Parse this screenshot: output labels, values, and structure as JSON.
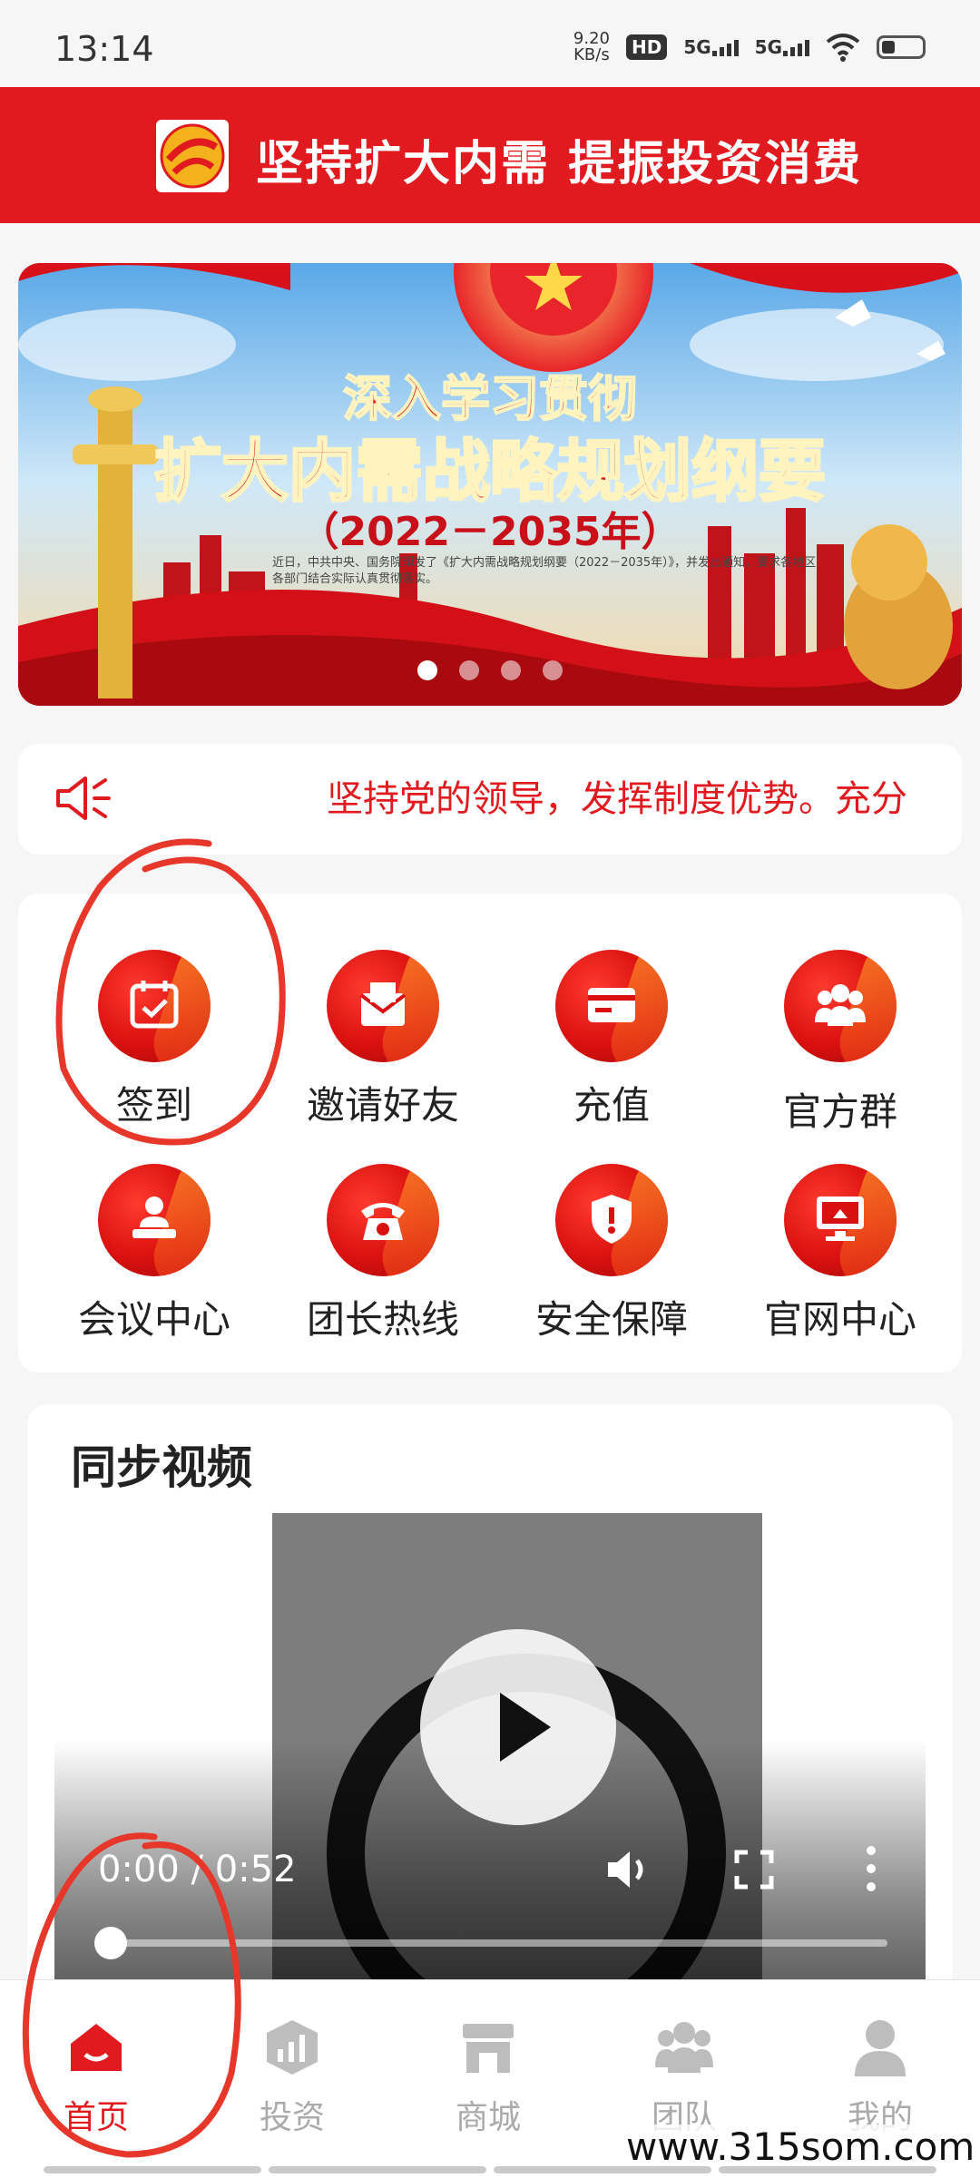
{
  "status_bar": {
    "time": "13:14",
    "net_speed_value": "9.20",
    "net_speed_unit": "KB/s",
    "hd_badge": "HD",
    "signal1": "5G",
    "signal2": "5G"
  },
  "header": {
    "title": "坚持扩大内需 提振投资消费"
  },
  "banner": {
    "line1": "深入学习贯彻",
    "line2": "扩大内需战略规划纲要",
    "line3": "（2022－2035年）",
    "small_text": "近日，中共中央、国务院印发了《扩大内需战略规划纲要（2022－2035年）》，并发出通知，要求各地区各部门结合实际认真贯彻落实。",
    "slide_count": 4,
    "active_slide": 1
  },
  "notice": {
    "text": "坚持党的领导，发挥制度优势。充分"
  },
  "menu": {
    "items": [
      {
        "label": "签到",
        "icon": "calendar-check-icon"
      },
      {
        "label": "邀请好友",
        "icon": "envelope-icon"
      },
      {
        "label": "充值",
        "icon": "card-icon"
      },
      {
        "label": "官方群",
        "icon": "group-icon"
      },
      {
        "label": "会议中心",
        "icon": "meeting-icon"
      },
      {
        "label": "团长热线",
        "icon": "phone-icon"
      },
      {
        "label": "安全保障",
        "icon": "shield-icon"
      },
      {
        "label": "官网中心",
        "icon": "monitor-icon"
      }
    ]
  },
  "video": {
    "title": "同步视频",
    "time": "0:00 / 0:52",
    "progress": 0
  },
  "bottom_nav": {
    "items": [
      {
        "label": "首页",
        "icon": "home-icon",
        "active": true
      },
      {
        "label": "投资",
        "icon": "chart-icon",
        "active": false
      },
      {
        "label": "商城",
        "icon": "store-icon",
        "active": false
      },
      {
        "label": "团队",
        "icon": "team-icon",
        "active": false
      },
      {
        "label": "我的",
        "icon": "user-icon",
        "active": false
      }
    ]
  },
  "watermark": "www.315som.com",
  "colors": {
    "brand_red": "#e01a1f",
    "annotation_red": "#e6372a",
    "inactive_gray": "#aaaaaa"
  }
}
